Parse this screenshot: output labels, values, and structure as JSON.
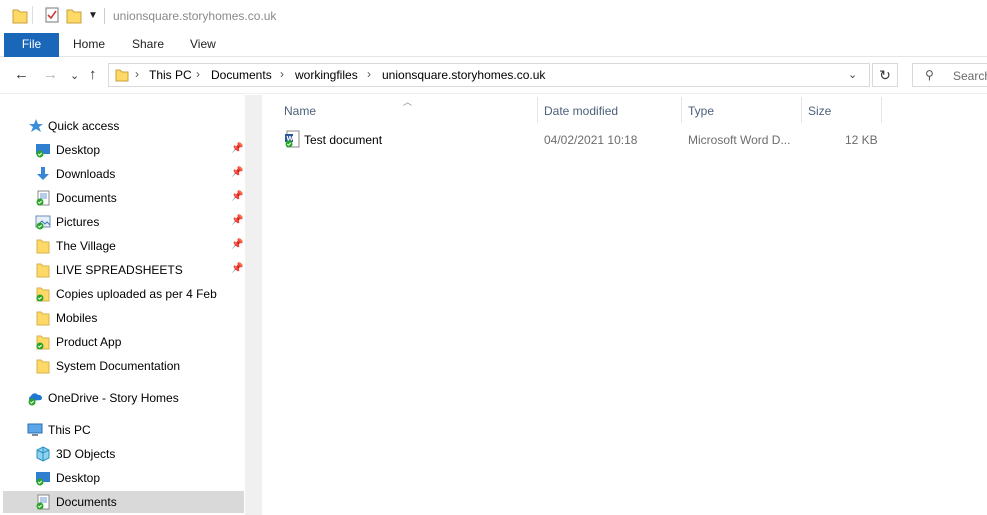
{
  "window": {
    "title": "unionsquare.storyhomes.co.uk"
  },
  "ribbon": {
    "tabs": [
      {
        "label": "File"
      },
      {
        "label": "Home"
      },
      {
        "label": "Share"
      },
      {
        "label": "View"
      }
    ]
  },
  "address": {
    "crumbs": [
      "This PC",
      "Documents",
      "workingfiles",
      "unionsquare.storyhomes.co.uk"
    ],
    "separator": "›"
  },
  "search": {
    "placeholder": "Search"
  },
  "navpane": {
    "items": [
      {
        "label": "Quick access",
        "icon": "star-icon"
      },
      {
        "label": "Desktop",
        "icon": "desktop-icon",
        "pinned": true
      },
      {
        "label": "Downloads",
        "icon": "download-icon",
        "pinned": true
      },
      {
        "label": "Documents",
        "icon": "documents-icon",
        "pinned": true
      },
      {
        "label": "Pictures",
        "icon": "pictures-icon",
        "pinned": true
      },
      {
        "label": "The Village",
        "icon": "folder-icon",
        "pinned": true
      },
      {
        "label": "LIVE SPREADSHEETS",
        "icon": "folder-icon",
        "pinned": true
      },
      {
        "label": "Copies uploaded as per 4 Feb",
        "icon": "folder-sync-icon"
      },
      {
        "label": "Mobiles",
        "icon": "folder-icon"
      },
      {
        "label": "Product App",
        "icon": "folder-sync-icon"
      },
      {
        "label": "System Documentation",
        "icon": "folder-icon"
      },
      {
        "label": "OneDrive - Story Homes",
        "icon": "onedrive-icon"
      },
      {
        "label": "This PC",
        "icon": "computer-icon"
      },
      {
        "label": "3D Objects",
        "icon": "cube-icon"
      },
      {
        "label": "Desktop",
        "icon": "desktop-icon"
      },
      {
        "label": "Documents",
        "icon": "documents-icon",
        "selected": true
      }
    ]
  },
  "columns": {
    "name": "Name",
    "date": "Date modified",
    "type": "Type",
    "size": "Size"
  },
  "files": [
    {
      "name": "Test document",
      "date": "04/02/2021 10:18",
      "type": "Microsoft Word D...",
      "size": "12 KB",
      "icon": "word-document-icon"
    }
  ],
  "colors": {
    "accent": "#1a67b9",
    "sync_green": "#2aa52a",
    "folder": "#ffd966"
  }
}
